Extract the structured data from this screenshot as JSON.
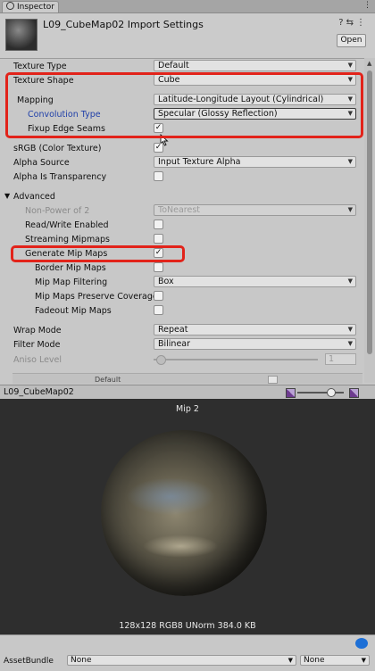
{
  "tab": {
    "label": "Inspector",
    "menu_icon": "kebab-menu-icon"
  },
  "header": {
    "title": "L09_CubeMap02 Import Settings",
    "open_label": "Open",
    "icons": "❓ ⇆ ⋮"
  },
  "settings": {
    "texture_type": {
      "label": "Texture Type",
      "value": "Default"
    },
    "texture_shape": {
      "label": "Texture Shape",
      "value": "Cube"
    },
    "mapping": {
      "label": "Mapping",
      "value": "Latitude-Longitude Layout (Cylindrical)"
    },
    "convolution_type": {
      "label": "Convolution Type",
      "value": "Specular (Glossy Reflection)"
    },
    "fixup_edge_seams": {
      "label": "Fixup Edge Seams",
      "checked": true
    },
    "srgb": {
      "label": "sRGB (Color Texture)",
      "checked": true
    },
    "alpha_source": {
      "label": "Alpha Source",
      "value": "Input Texture Alpha"
    },
    "alpha_is_transparency": {
      "label": "Alpha Is Transparency",
      "checked": false
    },
    "advanced": {
      "label": "Advanced"
    },
    "non_power_of_2": {
      "label": "Non-Power of 2",
      "value": "ToNearest"
    },
    "read_write": {
      "label": "Read/Write Enabled",
      "checked": false
    },
    "streaming_mipmaps": {
      "label": "Streaming Mipmaps",
      "checked": false
    },
    "generate_mip_maps": {
      "label": "Generate Mip Maps",
      "checked": true
    },
    "border_mip_maps": {
      "label": "Border Mip Maps",
      "checked": false
    },
    "mip_map_filtering": {
      "label": "Mip Map Filtering",
      "value": "Box"
    },
    "mip_maps_preserve_coverage": {
      "label": "Mip Maps Preserve Coverage",
      "checked": false
    },
    "fadeout_mip_maps": {
      "label": "Fadeout Mip Maps",
      "checked": false
    },
    "wrap_mode": {
      "label": "Wrap Mode",
      "value": "Repeat"
    },
    "filter_mode": {
      "label": "Filter Mode",
      "value": "Bilinear"
    },
    "aniso_level": {
      "label": "Aniso Level",
      "value": "1",
      "level_fraction": 0.0
    }
  },
  "platform": {
    "default_label": "Default"
  },
  "preview": {
    "title": "L09_CubeMap02",
    "mip_label": "Mip 2",
    "info": "128x128  RGB8 UNorm   384.0 KB"
  },
  "asset_bundle": {
    "label": "AssetBundle",
    "name_value": "None",
    "variant_value": "None"
  },
  "colors": {
    "highlight": "#e2231a",
    "accent_blue": "#1f3fa8"
  }
}
